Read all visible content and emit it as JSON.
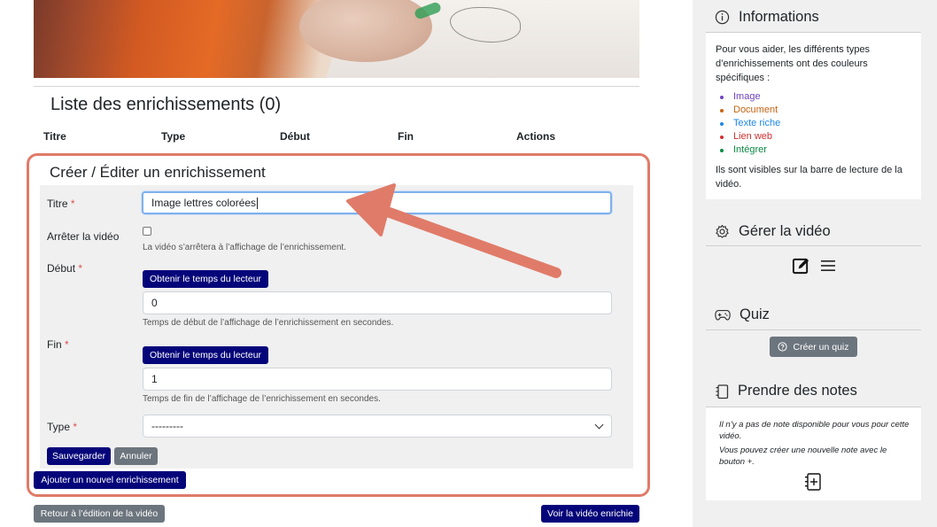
{
  "list": {
    "title": "Liste des enrichissements (0)",
    "columns": [
      "Titre",
      "Type",
      "Début",
      "Fin",
      "Actions"
    ]
  },
  "form": {
    "title": "Créer / Éditer un enrichissement",
    "required_mark": "*",
    "titre": {
      "label": "Titre",
      "value": "Image lettres colorées"
    },
    "stop": {
      "label": "Arrêter la vidéo",
      "help": "La vidéo s’arrêtera à l’affichage de l’enrichissement."
    },
    "debut": {
      "label": "Début",
      "button": "Obtenir le temps du lecteur",
      "value": "0",
      "help": "Temps de début de l’affichage de l’enrichissement en secondes."
    },
    "fin": {
      "label": "Fin",
      "button": "Obtenir le temps du lecteur",
      "value": "1",
      "help": "Temps de fin de l’affichage de l’enrichissement en secondes."
    },
    "type": {
      "label": "Type",
      "selected": "---------"
    },
    "save": "Sauvegarder",
    "cancel": "Annuler",
    "add_new": "Ajouter un nouvel enrichissement"
  },
  "footer": {
    "back": "Retour à l’édition de la vidéo",
    "view": "Voir la vidéo enrichie"
  },
  "sidebar": {
    "info": {
      "title": "Informations",
      "intro": "Pour vous aider, les différents types d’enrichissements ont des couleurs spécifiques :",
      "legend": [
        {
          "label": "Image",
          "color": "#6f42c1"
        },
        {
          "label": "Document",
          "color": "#c86414"
        },
        {
          "label": "Texte riche",
          "color": "#1e88e5"
        },
        {
          "label": "Lien web",
          "color": "#d32f2f"
        },
        {
          "label": "Intégrer",
          "color": "#0b8a44"
        }
      ],
      "outro": "Ils sont visibles sur la barre de lecture de la vidéo."
    },
    "manage": {
      "title": "Gérer la vidéo"
    },
    "quiz": {
      "title": "Quiz",
      "button": "Créer un quiz"
    },
    "notes": {
      "title": "Prendre des notes",
      "empty": "Il n’y a pas de note disponible pour vous pour cette vidéo.",
      "hint": "Vous pouvez créer une nouvelle note avec le bouton +."
    }
  }
}
